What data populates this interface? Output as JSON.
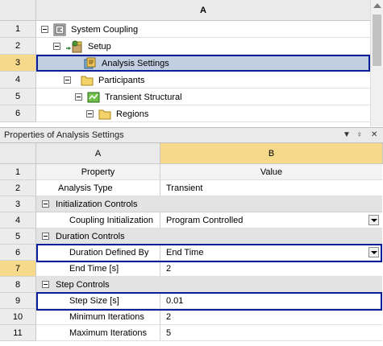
{
  "outline": {
    "column_header": "A",
    "rows": [
      {
        "num": "1",
        "label": "System Coupling",
        "icon": "system-coupling-icon"
      },
      {
        "num": "2",
        "label": "Setup",
        "icon": "setup-icon"
      },
      {
        "num": "3",
        "label": "Analysis Settings",
        "icon": "analysis-settings-icon"
      },
      {
        "num": "4",
        "label": "Participants",
        "icon": "folder-icon"
      },
      {
        "num": "5",
        "label": "Transient Structural",
        "icon": "transient-structural-icon"
      },
      {
        "num": "6",
        "label": "Regions",
        "icon": "folder-icon"
      }
    ]
  },
  "properties": {
    "title": "Properties of Analysis Settings",
    "title_controls": {
      "dropdown": "▼",
      "pin": "♀",
      "close": "✕"
    },
    "col_headers": [
      "A",
      "B"
    ],
    "col_subheaders": {
      "property": "Property",
      "value": "Value"
    },
    "rows": [
      {
        "num": "1",
        "type": "header"
      },
      {
        "num": "2",
        "type": "prop",
        "label": "Analysis Type",
        "value": "Transient"
      },
      {
        "num": "3",
        "type": "group",
        "label": "Initialization Controls"
      },
      {
        "num": "4",
        "type": "prop",
        "label": "Coupling Initialization",
        "value": "Program Controlled",
        "dropdown": true
      },
      {
        "num": "5",
        "type": "group",
        "label": "Duration Controls"
      },
      {
        "num": "6",
        "type": "prop",
        "label": "Duration Defined By",
        "value": "End Time",
        "dropdown": true
      },
      {
        "num": "7",
        "type": "prop",
        "label": "End Time [s]",
        "value": "2"
      },
      {
        "num": "8",
        "type": "group",
        "label": "Step Controls"
      },
      {
        "num": "9",
        "type": "prop",
        "label": "Step Size [s]",
        "value": "0.01"
      },
      {
        "num": "10",
        "type": "prop",
        "label": "Minimum Iterations",
        "value": "2"
      },
      {
        "num": "11",
        "type": "prop",
        "label": "Maximum Iterations",
        "value": "5"
      }
    ]
  },
  "colors": {
    "selection_border": "#0b1e9a",
    "selection_fill": "#c2cfe2",
    "active_row_number": "#f6d98b",
    "group_row": "#e3e3e3"
  }
}
